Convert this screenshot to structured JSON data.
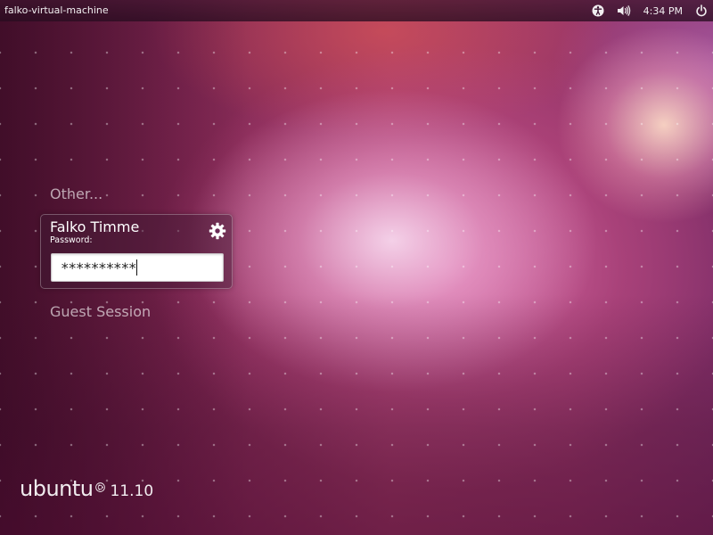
{
  "top_panel": {
    "hostname": "falko-virtual-machine",
    "icons": [
      "accessibility-icon",
      "volume-icon",
      "power-icon"
    ],
    "clock": "4:34 PM"
  },
  "greeter": {
    "other_label": "Other...",
    "selected_user": {
      "name": "Falko Timme",
      "password_label": "Password:",
      "password_value": "**********",
      "session_icon": "gear-icon"
    },
    "guest_label": "Guest Session"
  },
  "branding": {
    "wordmark": "ubuntu",
    "logo_icon": "circle-of-friends-icon",
    "version": "11.10"
  },
  "colors": {
    "panel_bg": "#2c0f22",
    "wallpaper_accent": "#a23a68",
    "field_bg": "#ffffff"
  }
}
